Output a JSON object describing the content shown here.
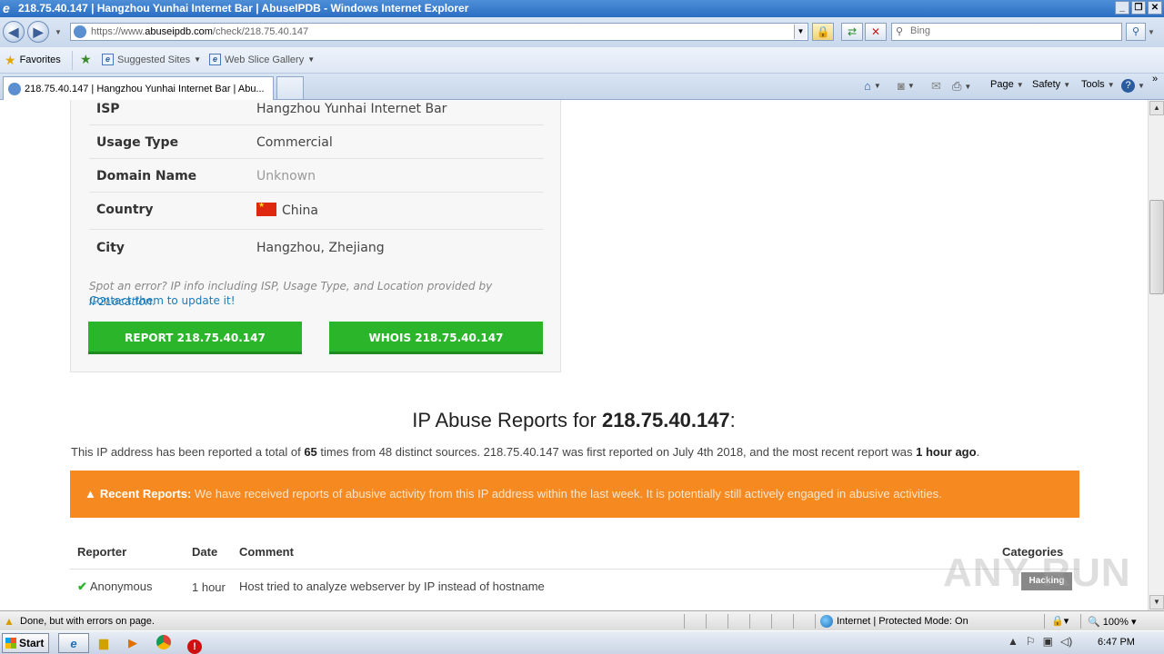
{
  "window": {
    "title": "218.75.40.147 | Hangzhou Yunhai Internet Bar | AbuseIPDB - Windows Internet Explorer",
    "min": "_",
    "max": "❐",
    "close": "✕"
  },
  "address": {
    "url_prefix": "https://www.",
    "url_domain": "abuseipdb.com",
    "url_path": "/check/218.75.40.147",
    "search_placeholder": "Bing"
  },
  "favorites": {
    "label": "Favorites",
    "items": [
      {
        "label": "Suggested Sites"
      },
      {
        "label": "Web Slice Gallery"
      }
    ]
  },
  "tab": {
    "label": "218.75.40.147 | Hangzhou Yunhai Internet Bar | Abu..."
  },
  "commandbar": {
    "page": "Page",
    "safety": "Safety",
    "tools": "Tools",
    "help": "?"
  },
  "ipinfo": {
    "rows": [
      {
        "key": "ISP",
        "value": "Hangzhou Yunhai Internet Bar"
      },
      {
        "key": "Usage Type",
        "value": "Commercial"
      },
      {
        "key": "Domain Name",
        "value": "Unknown"
      },
      {
        "key": "Country",
        "value": "China"
      },
      {
        "key": "City",
        "value": "Hangzhou, Zhejiang"
      }
    ],
    "note_prefix": "Spot an error? IP info including ISP, Usage Type, and Location provided by",
    "note_link": "IP2Location",
    "note_suffix": ".",
    "contact": "Contact them to update it!",
    "report_button": "REPORT 218.75.40.147",
    "whois_button": "WHOIS 218.75.40.147"
  },
  "reports": {
    "heading_prefix": "IP Abuse Reports for",
    "heading_ip": "218.75.40.147",
    "heading_suffix": ":",
    "summary_1": "This IP address has been reported a total of",
    "summary_count": "65",
    "summary_2": "times from 48 distinct sources. 218.75.40.147 was first reported on July 4th 2018, and the most recent report was",
    "summary_recent": "1 hour ago",
    "summary_3": ".",
    "alert_title": "Recent Reports:",
    "alert_msg": "We have received reports of abusive activity from this IP address within the last week. It is potentially still actively engaged in abusive activities.",
    "columns": [
      "Reporter",
      "Date",
      "Comment",
      "Categories"
    ],
    "rows": [
      {
        "reporter": "Anonymous",
        "date": "1 hour",
        "comment": "Host tried to analyze webserver by IP instead of hostname",
        "category": "Hacking"
      }
    ]
  },
  "watermark": "ANY RUN",
  "status": {
    "text": "Done, but with errors on page.",
    "zone": "Internet | Protected Mode: On",
    "zoom": "100%"
  },
  "taskbar": {
    "start": "Start",
    "clock": "6:47 PM"
  }
}
